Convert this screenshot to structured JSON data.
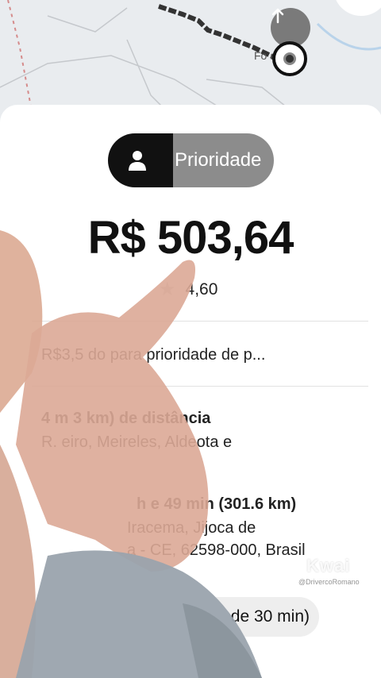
{
  "map": {
    "city_label": "Fo      a",
    "up_button_icon": "arrow-up-icon",
    "pin_icon": "location-pin-icon"
  },
  "ride": {
    "tier_label": "Prioridade",
    "tier_icon": "person-icon",
    "price": "R$ 503,64",
    "rating": "4,60",
    "priority_fee_text": "R$3,5          do para prioridade de p...",
    "pickup": {
      "distance": "4 m        3 km) de distância",
      "address": "R.        eiro, Meireles, Aldeota e"
    },
    "trip": {
      "duration": "h e 49 min (301.6 km)",
      "address_line1": "Iracema, Jijoca de",
      "address_line2": "a - CE, 62598-000, Brasil"
    },
    "chip_text": "de 30 min)"
  },
  "watermark": {
    "brand": "Kwai",
    "user": "@DrivercoRomano"
  },
  "colors": {
    "pill_dark": "#111111",
    "pill_gray": "#8c8c8c",
    "sheet_bg": "#ffffff",
    "map_bg": "#e9ecef"
  }
}
